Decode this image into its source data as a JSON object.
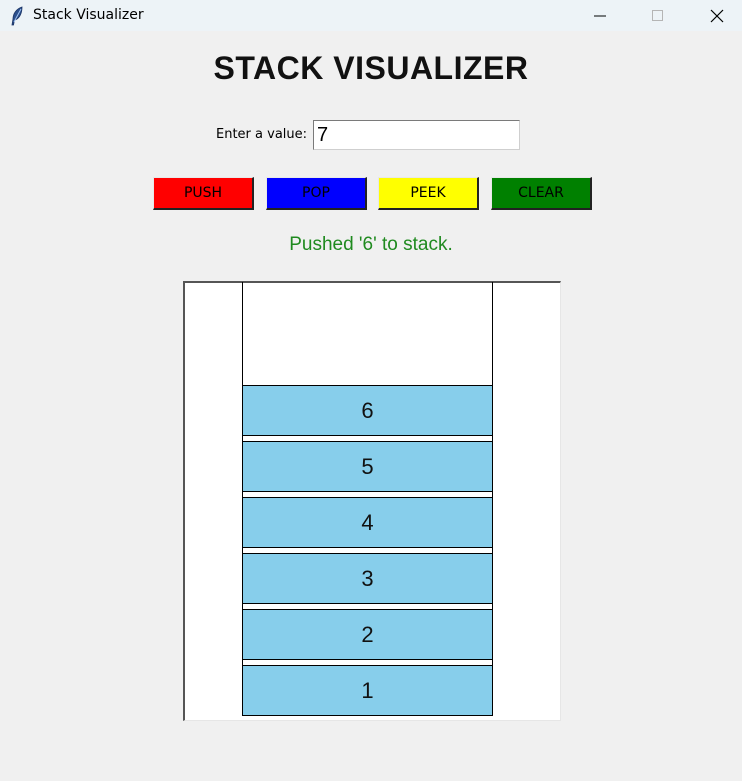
{
  "window": {
    "title": "Stack Visualizer",
    "controls": [
      "minimize",
      "maximize",
      "close"
    ]
  },
  "app": {
    "title": "STACK VISUALIZER",
    "input_label": "Enter a value:",
    "input_value": "7",
    "buttons": {
      "push": {
        "label": "PUSH",
        "color": "#ff0000"
      },
      "pop": {
        "label": "POP",
        "color": "#0000ff"
      },
      "peek": {
        "label": "PEEK",
        "color": "#ffff00"
      },
      "clear": {
        "label": "CLEAR",
        "color": "#008000"
      }
    },
    "status": {
      "text": "Pushed '6' to stack.",
      "color": "#1f8a1f"
    },
    "stack": {
      "item_color": "#87ceeb",
      "items_top_to_bottom": [
        "6",
        "5",
        "4",
        "3",
        "2",
        "1"
      ]
    }
  }
}
